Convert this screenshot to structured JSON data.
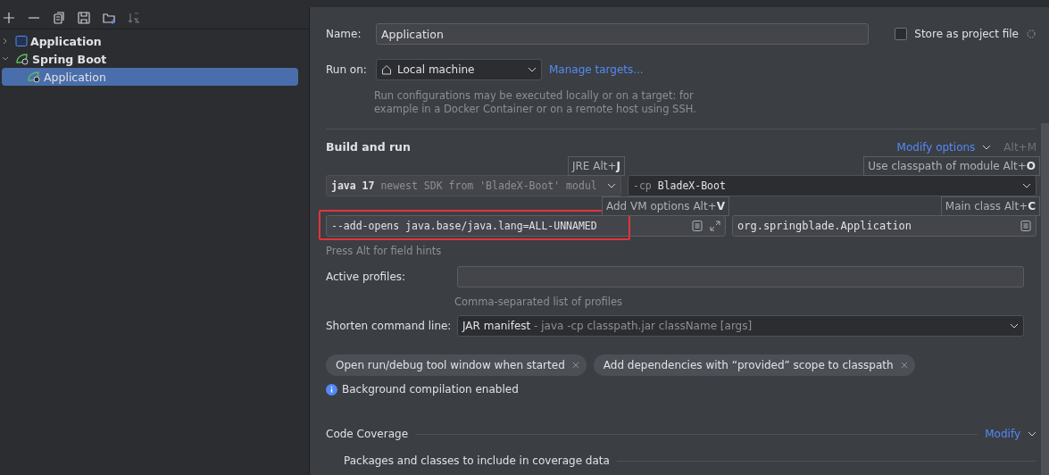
{
  "toolbar": {
    "buttons": [
      {
        "kind": "add"
      },
      {
        "kind": "remove"
      },
      {
        "kind": "copy"
      },
      {
        "kind": "save"
      },
      {
        "kind": "folder"
      },
      {
        "kind": "sort",
        "disabled": true
      }
    ]
  },
  "tree": [
    {
      "label": "Application",
      "expanded": false
    },
    {
      "label": "Spring Boot",
      "expanded": true,
      "children": [
        {
          "label": "Application",
          "selected": true
        }
      ]
    }
  ],
  "name": {
    "label": "Name:",
    "value": "Application"
  },
  "store_as_project_file": {
    "label": "Store as project file",
    "checked": false
  },
  "run_on": {
    "label": "Run on:",
    "value": "Local machine",
    "link": "Manage targets...",
    "hint": "Run configurations may be executed locally or on a target: for example in a Docker Container or on a remote host using SSH."
  },
  "build_and_run": {
    "title": "Build and run",
    "modify": "Modify options",
    "modify_shortcut": "Alt+M",
    "jre": {
      "bold": "java 17",
      "rest": "newest SDK from 'BladeX-Boot' modul",
      "tooltip": "JRE Alt+",
      "key": "J"
    },
    "classpath": {
      "prefix": "-cp",
      "value": "BladeX-Boot",
      "tooltip": "Use classpath of module Alt+",
      "key": "O"
    },
    "vm_options": {
      "value": "--add-opens java.base/java.lang=ALL-UNNAMED",
      "tooltip": "Add VM options Alt+",
      "key": "V",
      "highlighted": true
    },
    "main_class": {
      "value": "org.springblade.Application",
      "tooltip": "Main class Alt+",
      "key": "C"
    },
    "hint": "Press Alt for field hints"
  },
  "active_profiles": {
    "label": "Active profiles:",
    "hint": "Comma-separated list of profiles"
  },
  "shorten": {
    "label": "Shorten command line:",
    "bold": "JAR manifest",
    "rest": " - java -cp classpath.jar className [args]"
  },
  "chips": [
    "Open run/debug tool window when started",
    "Add dependencies with “provided” scope to classpath"
  ],
  "info": "Background compilation enabled",
  "code_coverage": {
    "title": "Code Coverage",
    "modify": "Modify",
    "sub": "Packages and classes to include in coverage data"
  }
}
